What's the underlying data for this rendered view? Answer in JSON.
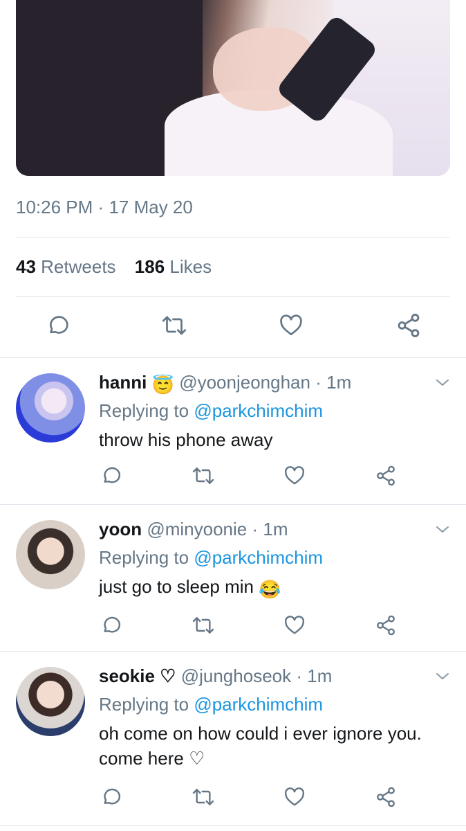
{
  "tweet": {
    "time": "10:26 PM",
    "sep": "·",
    "date": "17 May 20",
    "retweet_count": "43",
    "retweet_label": "Retweets",
    "like_count": "186",
    "like_label": "Likes"
  },
  "icons": {
    "reply": "reply-bubble-icon",
    "retweet": "retweet-icon",
    "like": "heart-icon",
    "share": "share-icon",
    "more": "chevron-down-icon"
  },
  "colors": {
    "accent": "#1b95e0",
    "secondary": "#657786",
    "text": "#14171a",
    "divider": "#e1e8ed"
  },
  "replies": [
    {
      "name": "hanni",
      "handle": "@yoonjeonghan",
      "time": "1m",
      "replying_prefix": "Replying to",
      "replying_to": "@parkchimchim",
      "text_lines": [
        "throw his phone away"
      ],
      "name_emoji": "😇"
    },
    {
      "name": "yoon",
      "handle": "@minyoonie",
      "time": "1m",
      "replying_prefix": "Replying to",
      "replying_to": "@parkchimchim",
      "text_lines": [
        "just go to sleep min"
      ],
      "text_emoji": "😂"
    },
    {
      "name": "seokie ♡",
      "handle": "@junghoseok",
      "time": "1m",
      "replying_prefix": "Replying to",
      "replying_to": "@parkchimchim",
      "text_lines": [
        "oh come on how could i ever ignore you.",
        "come here ♡"
      ]
    }
  ]
}
